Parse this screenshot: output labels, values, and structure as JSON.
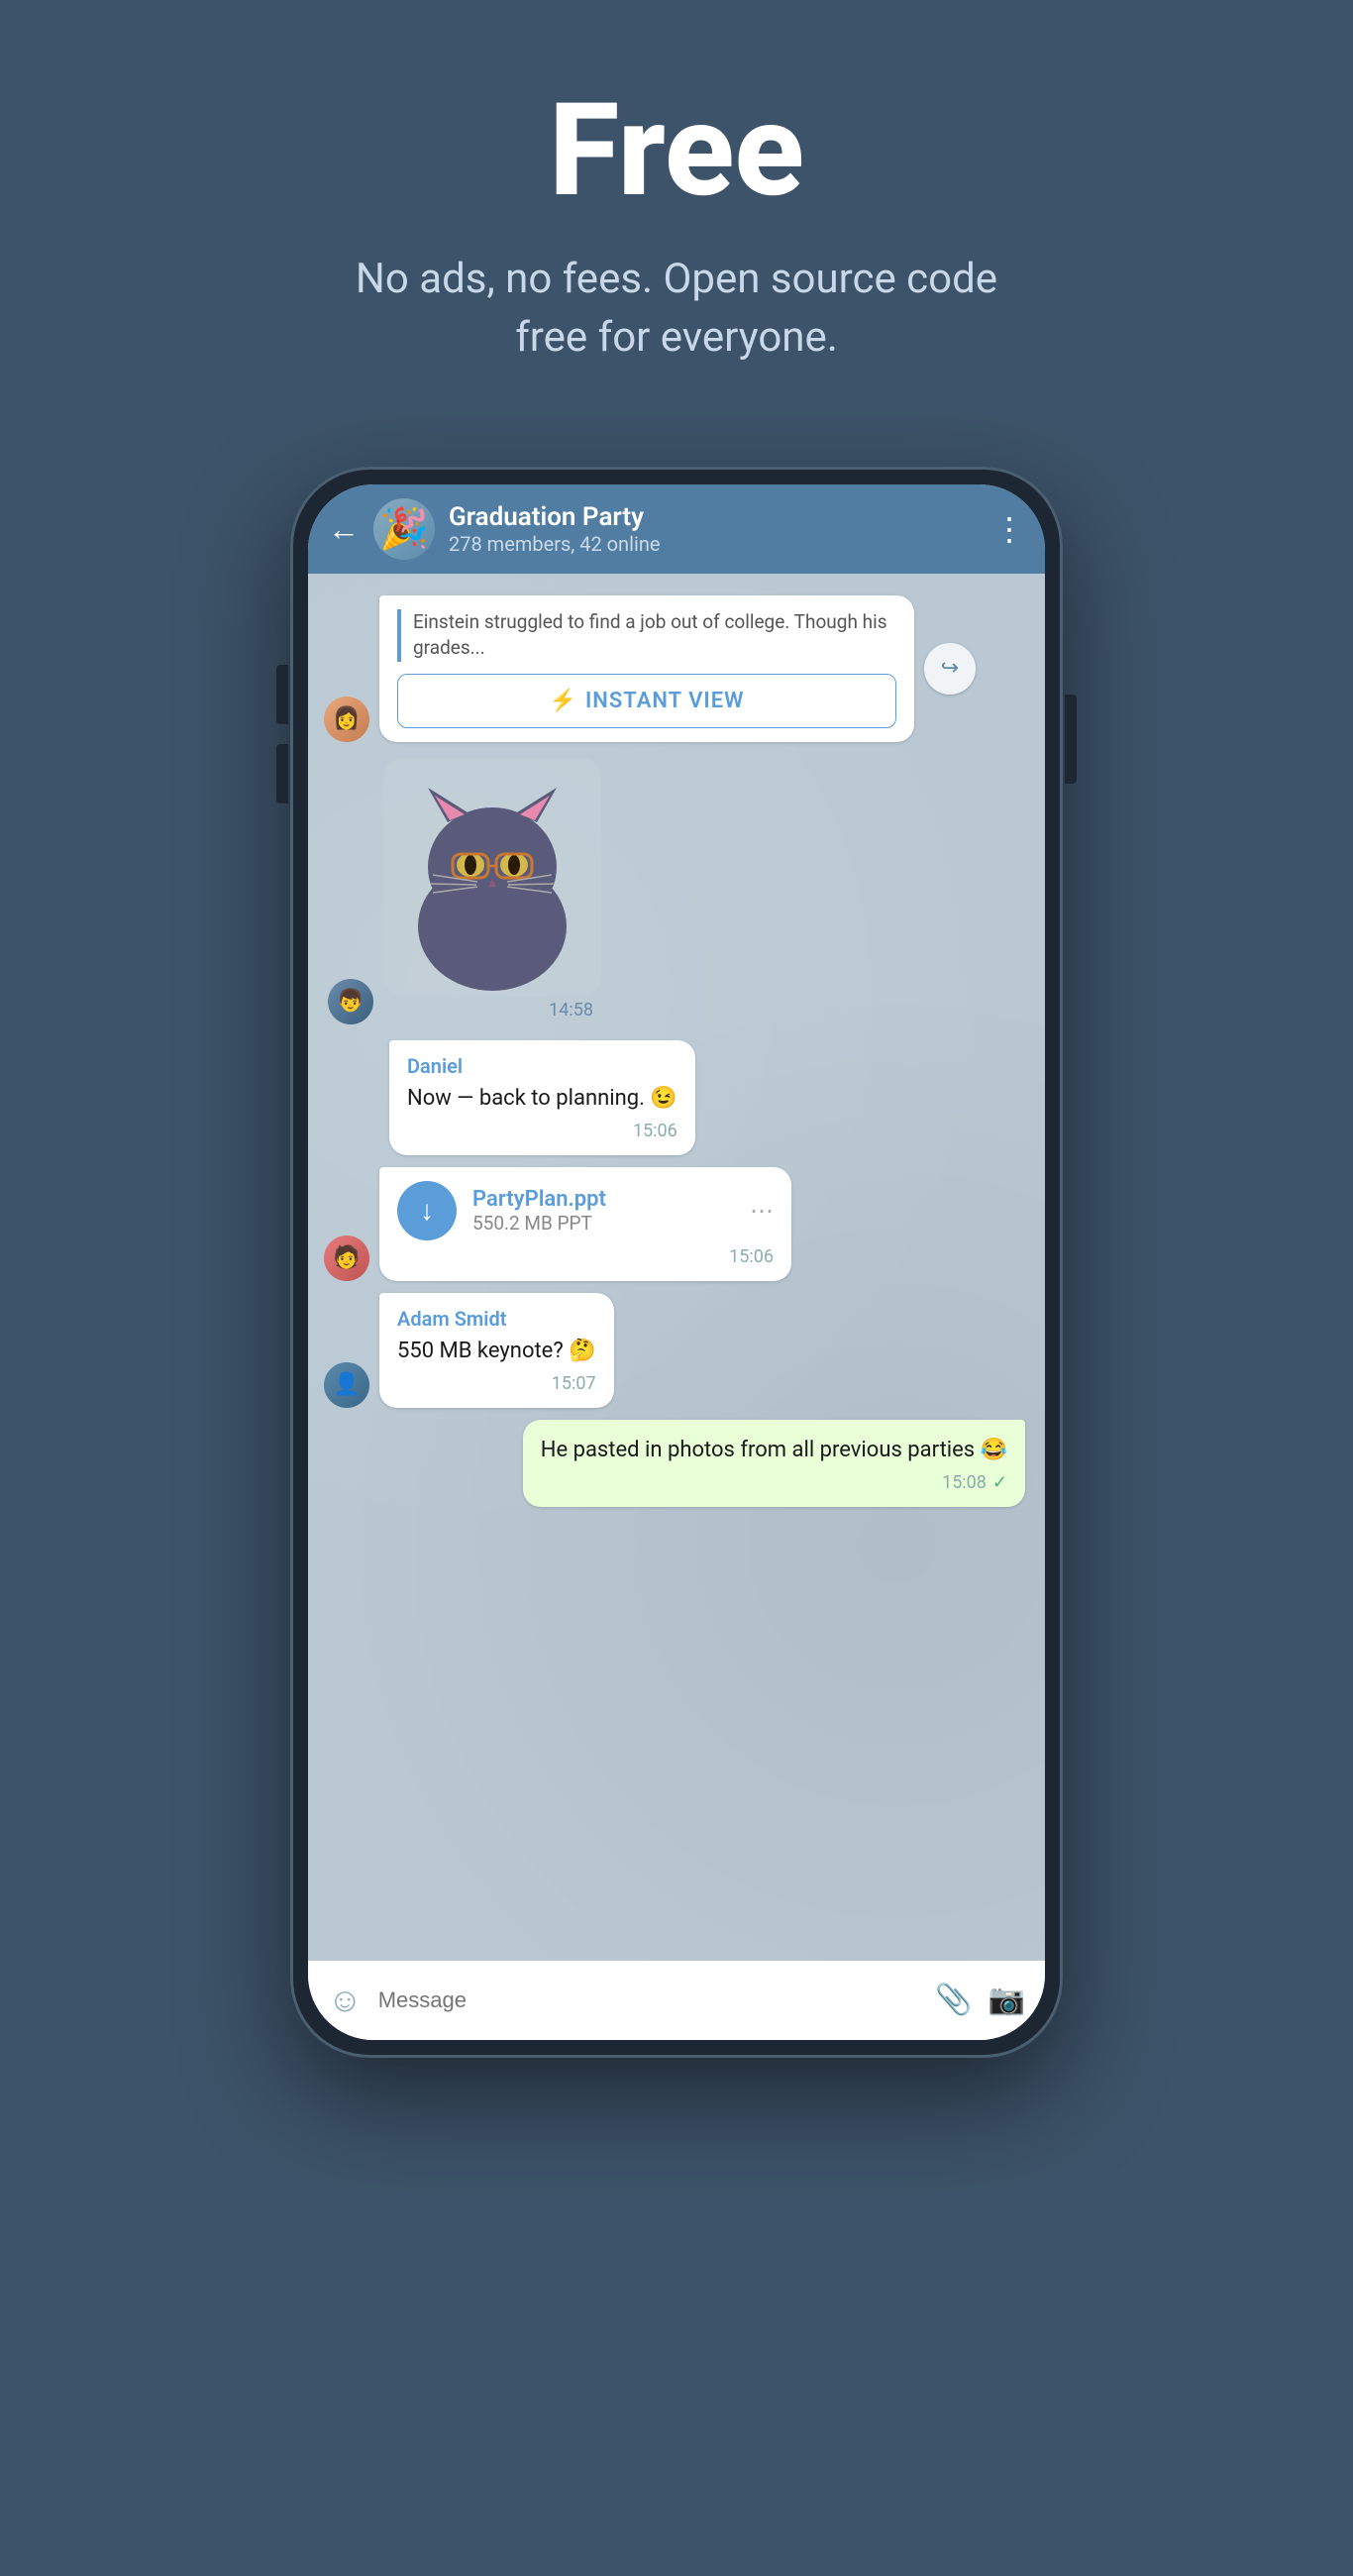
{
  "hero": {
    "title": "Free",
    "subtitle": "No ads, no fees. Open source code free for everyone."
  },
  "phone": {
    "header": {
      "group_name": "Graduation Party",
      "group_info": "278 members, 42 online",
      "back_label": "←",
      "menu_label": "⋮"
    },
    "messages": [
      {
        "id": "article-msg",
        "type": "article",
        "sender_avatar": "emoji_girl",
        "article_title": "Einstein struggled to find a job out of college. Though his grades...",
        "instant_view_label": "INSTANT VIEW",
        "instant_view_icon": "⚡",
        "share_icon": "↪"
      },
      {
        "id": "sticker-msg",
        "type": "sticker",
        "sender_avatar": "emoji_boy1",
        "sticker_emoji": "🐱",
        "time": "14:58"
      },
      {
        "id": "daniel-msg",
        "type": "text",
        "sender": "Daniel",
        "sender_color": "blue",
        "text": "Now — back to planning. 😉",
        "time": "15:06"
      },
      {
        "id": "file-msg",
        "type": "file",
        "sender_avatar": "emoji_boy2",
        "file_name": "PartyPlan.ppt",
        "file_size": "550.2 MB PPT",
        "file_icon": "↓",
        "time": "15:06",
        "menu_icon": "⋯"
      },
      {
        "id": "adam-msg",
        "type": "text",
        "sender": "Adam Smidt",
        "sender_color": "blue",
        "sender_avatar": "emoji_boy3",
        "text": "550 MB keynote? 🤔",
        "time": "15:07"
      },
      {
        "id": "own-msg",
        "type": "text_own",
        "text": "He pasted in photos from all previous parties 😂",
        "time": "15:08",
        "check": "✓"
      }
    ],
    "input_bar": {
      "placeholder": "Message",
      "emoji_icon": "☺",
      "attach_icon": "📎",
      "camera_icon": "📷"
    }
  }
}
